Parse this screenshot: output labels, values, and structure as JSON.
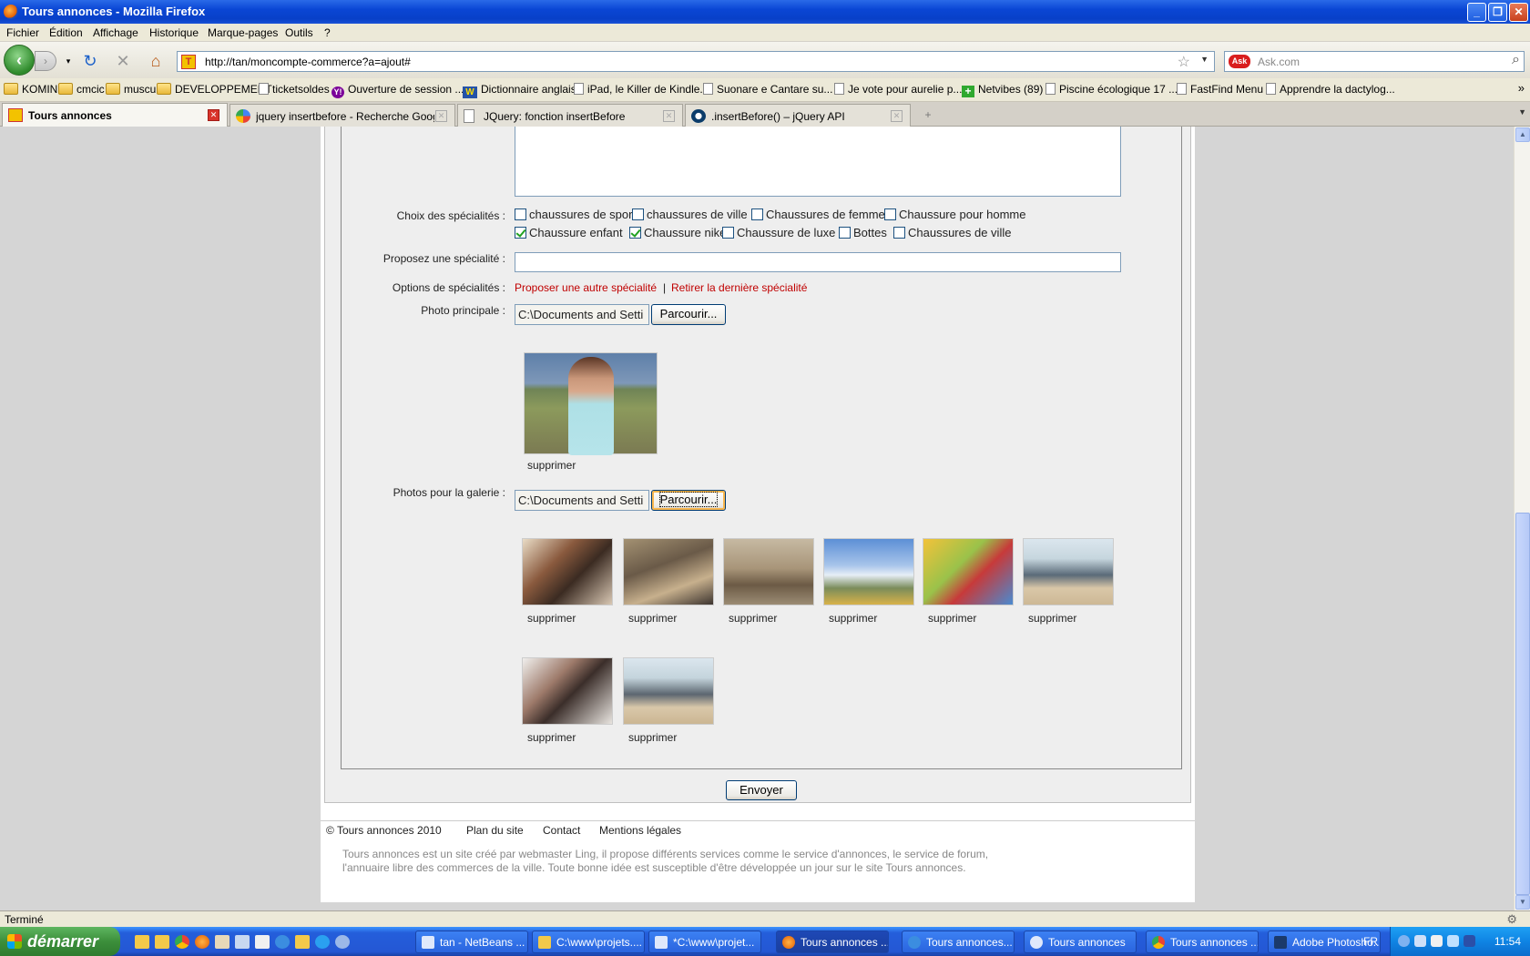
{
  "window": {
    "title": "Tours annonces - Mozilla Firefox",
    "minimize": "_",
    "maximize": "❐",
    "close": "✕"
  },
  "menu": [
    "Fichier",
    "Édition",
    "Affichage",
    "Historique",
    "Marque-pages",
    "Outils",
    "?"
  ],
  "nav": {
    "url": "http://tan/moncompte-commerce?a=ajout#",
    "site_icon_text": "T",
    "search_placeholder": "Ask.com",
    "search_engine": "Ask"
  },
  "bookmarks": [
    {
      "label": "KOMIN",
      "icon": "folder"
    },
    {
      "label": "cmcic",
      "icon": "folder"
    },
    {
      "label": "muscu",
      "icon": "folder"
    },
    {
      "label": "DEVELOPPEMENT",
      "icon": "folder"
    },
    {
      "label": "ticketsoldes",
      "icon": "page"
    },
    {
      "label": "Ouverture de session ...",
      "icon": "yahoo"
    },
    {
      "label": "Dictionnaire anglais",
      "icon": "wr"
    },
    {
      "label": "iPad, le Killer de Kindle...",
      "icon": "page"
    },
    {
      "label": "Suonare e Cantare su...",
      "icon": "page"
    },
    {
      "label": "Je vote pour aurelie p...",
      "icon": "page"
    },
    {
      "label": "Netvibes (89)",
      "icon": "plus"
    },
    {
      "label": "Piscine écologique 17 ...",
      "icon": "page"
    },
    {
      "label": "FastFind Menu",
      "icon": "page"
    },
    {
      "label": "Apprendre la dactylog...",
      "icon": "page"
    }
  ],
  "tabs": [
    {
      "label": "Tours annonces",
      "active": true
    },
    {
      "label": "jquery insertbefore - Recherche Google",
      "active": false
    },
    {
      "label": "JQuery: fonction insertBefore",
      "active": false
    },
    {
      "label": ".insertBefore() – jQuery API",
      "active": false
    }
  ],
  "form": {
    "specialites_label": "Choix des spécialités :",
    "specialites_row1": [
      {
        "label": "chaussures de sport",
        "checked": false
      },
      {
        "label": "chaussures de ville",
        "checked": false
      },
      {
        "label": "Chaussures de femme",
        "checked": false
      },
      {
        "label": "Chaussure pour homme",
        "checked": false
      }
    ],
    "specialites_row2": [
      {
        "label": "Chaussure enfant",
        "checked": true
      },
      {
        "label": "Chaussure nike",
        "checked": true
      },
      {
        "label": "Chaussure de luxe",
        "checked": false
      },
      {
        "label": "Bottes",
        "checked": false
      },
      {
        "label": "Chaussures de ville",
        "checked": false
      }
    ],
    "propose_label": "Proposez une spécialité :",
    "options_label": "Options de spécialités :",
    "option_add": "Proposer une autre spécialité",
    "option_sep": "|",
    "option_remove": "Retirer la dernière spécialité",
    "photo_label": "Photo principale :",
    "file_value": "C:\\Documents and Setti",
    "browse_label": "Parcourir...",
    "gallery_label": "Photos pour la galerie :",
    "delete_label": "supprimer",
    "submit_label": "Envoyer"
  },
  "footer": {
    "copyright": "© Tours annonces 2010",
    "links": [
      "Plan du site",
      "Contact",
      "Mentions légales"
    ],
    "description": "Tours annonces est un site créé par webmaster Ling, il propose différents services comme le service d'annonces, le service de forum, l'annuaire libre des commerces de la ville. Toute bonne idée est susceptible d'être développée un jour sur le site Tours annonces."
  },
  "status": "Terminé",
  "taskbar": {
    "start": "démarrer",
    "items": [
      {
        "label": "tan - NetBeans ...",
        "active": false
      },
      {
        "label": "C:\\www\\projets....",
        "active": false
      },
      {
        "label": "*C:\\www\\projet...",
        "active": false
      },
      {
        "label": "Tours annonces ...",
        "active": true
      },
      {
        "label": "Tours annonces...",
        "active": false
      },
      {
        "label": "Tours annonces",
        "active": false
      },
      {
        "label": "Tours annonces ...",
        "active": false
      },
      {
        "label": "Adobe Photosho...",
        "active": false
      }
    ],
    "lang": "FR",
    "clock": "11:54"
  },
  "colors": {
    "link_red": "#c00000",
    "xp_blue": "#245edb"
  }
}
